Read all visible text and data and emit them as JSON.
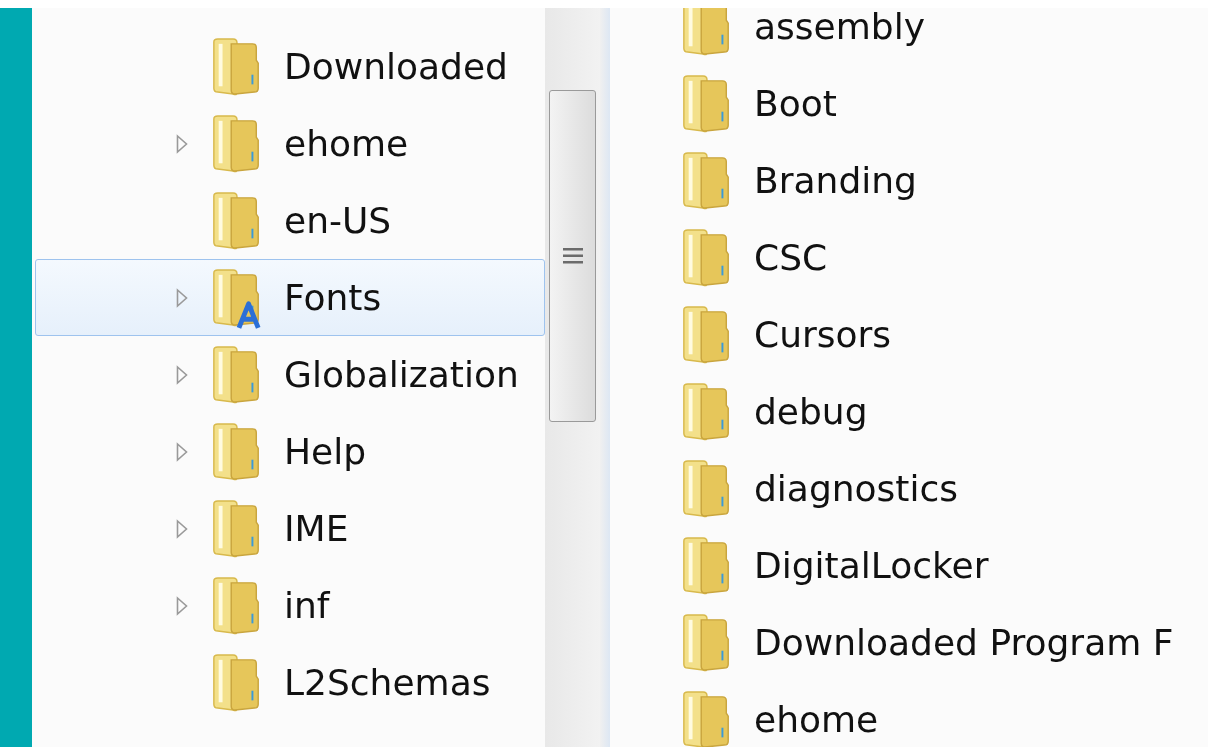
{
  "navigation_tree": {
    "items": [
      {
        "label": "Downloaded",
        "kind": "folder",
        "has_children": false,
        "selected": false
      },
      {
        "label": "ehome",
        "kind": "folder",
        "has_children": true,
        "selected": false
      },
      {
        "label": "en-US",
        "kind": "folder",
        "has_children": false,
        "selected": false
      },
      {
        "label": "Fonts",
        "kind": "fonts",
        "has_children": true,
        "selected": true
      },
      {
        "label": "Globalization",
        "kind": "folder",
        "has_children": true,
        "selected": false
      },
      {
        "label": "Help",
        "kind": "folder",
        "has_children": true,
        "selected": false
      },
      {
        "label": "IME",
        "kind": "folder",
        "has_children": true,
        "selected": false
      },
      {
        "label": "inf",
        "kind": "folder",
        "has_children": true,
        "selected": false
      },
      {
        "label": "L2Schemas",
        "kind": "folder",
        "has_children": false,
        "selected": false
      }
    ]
  },
  "file_list": {
    "items": [
      {
        "label": "assembly"
      },
      {
        "label": "Boot"
      },
      {
        "label": "Branding"
      },
      {
        "label": "CSC"
      },
      {
        "label": "Cursors"
      },
      {
        "label": "debug"
      },
      {
        "label": "diagnostics"
      },
      {
        "label": "DigitalLocker"
      },
      {
        "label": "Downloaded Program F"
      },
      {
        "label": "ehome"
      }
    ]
  }
}
